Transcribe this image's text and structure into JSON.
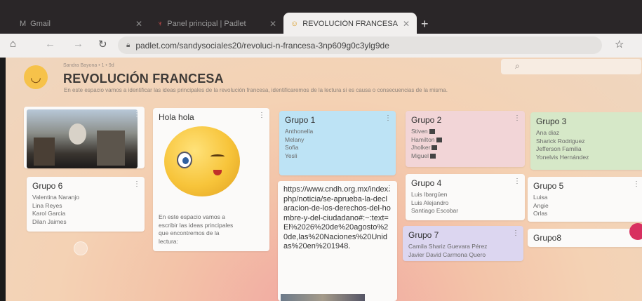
{
  "browser": {
    "tabs": [
      {
        "icon": "gmail-icon",
        "glyph": "M",
        "label": "Gmail"
      },
      {
        "icon": "padlet-icon",
        "glyph": "♆",
        "label": "Panel principal | Padlet"
      },
      {
        "icon": "padlet-emoji-icon",
        "glyph": "☺",
        "label": "REVOLUCIÓN FRANCESA"
      }
    ],
    "url": "padlet.com/sandysociales20/revoluci-n-francesa-3np609g0c3ylg9de"
  },
  "board": {
    "author": "Sandra Bayona • 1 • 9d",
    "title": "REVOLUCIÓN FRANCESA",
    "description": "En este espacio vamos a identificar las ideas principales de la revolución francesa, identificaremos de la lectura si es causa o consecuencias de la misma."
  },
  "cards": {
    "hola": {
      "title": "Hola hola",
      "body": [
        "En este espacio vamos a",
        "escribir las ideas principales",
        "que encontremos de la",
        "lectura:"
      ]
    },
    "link": {
      "text": "https://www.cndh.org.mx/index.php/noticia/se-aprueba-la-declaracion-de-los-derechos-del-hombre-y-del-ciudadano#:~:text=El%2026%20de%20agosto%20de,las%20Naciones%20Unidas%20en%201948."
    },
    "grupo1": {
      "title": "Grupo 1",
      "members": [
        "Anthonella",
        "Melany",
        "Sofia",
        "Yesli"
      ]
    },
    "grupo2": {
      "title": "Grupo 2",
      "members": [
        "Stiven",
        "Hamilton",
        "Jholker",
        "Miguel"
      ]
    },
    "grupo3": {
      "title": "Grupo 3",
      "members": [
        "Ana diaz",
        "Sharick Rodriguez",
        "Jefferson Familia",
        "Yonelvis Hernández"
      ]
    },
    "grupo4": {
      "title": "Grupo 4",
      "members": [
        "Luis Ibargüen",
        "Luis Alejandro",
        "Santiago Escobar"
      ]
    },
    "grupo5": {
      "title": "Grupo 5",
      "members": [
        "Luisa",
        "Angie",
        "Orlas"
      ]
    },
    "grupo6": {
      "title": "Grupo 6",
      "members": [
        "Valentina Naranjo",
        "Lina Reyes",
        "Karol Garcia",
        "Dilan Jaimes"
      ]
    },
    "grupo7": {
      "title": "Grupo 7",
      "members": [
        "Camila Shariz Guevara Pérez",
        "Javier David Carmona Quero"
      ]
    },
    "grupo8": {
      "title": "Grupo8"
    }
  },
  "colors": {
    "accent": "#d83060",
    "blue_card": "#bde3f5",
    "pink_card": "#f2d5d7",
    "green_card": "#d6e8c8",
    "lilac_card": "#dcd6f0"
  }
}
